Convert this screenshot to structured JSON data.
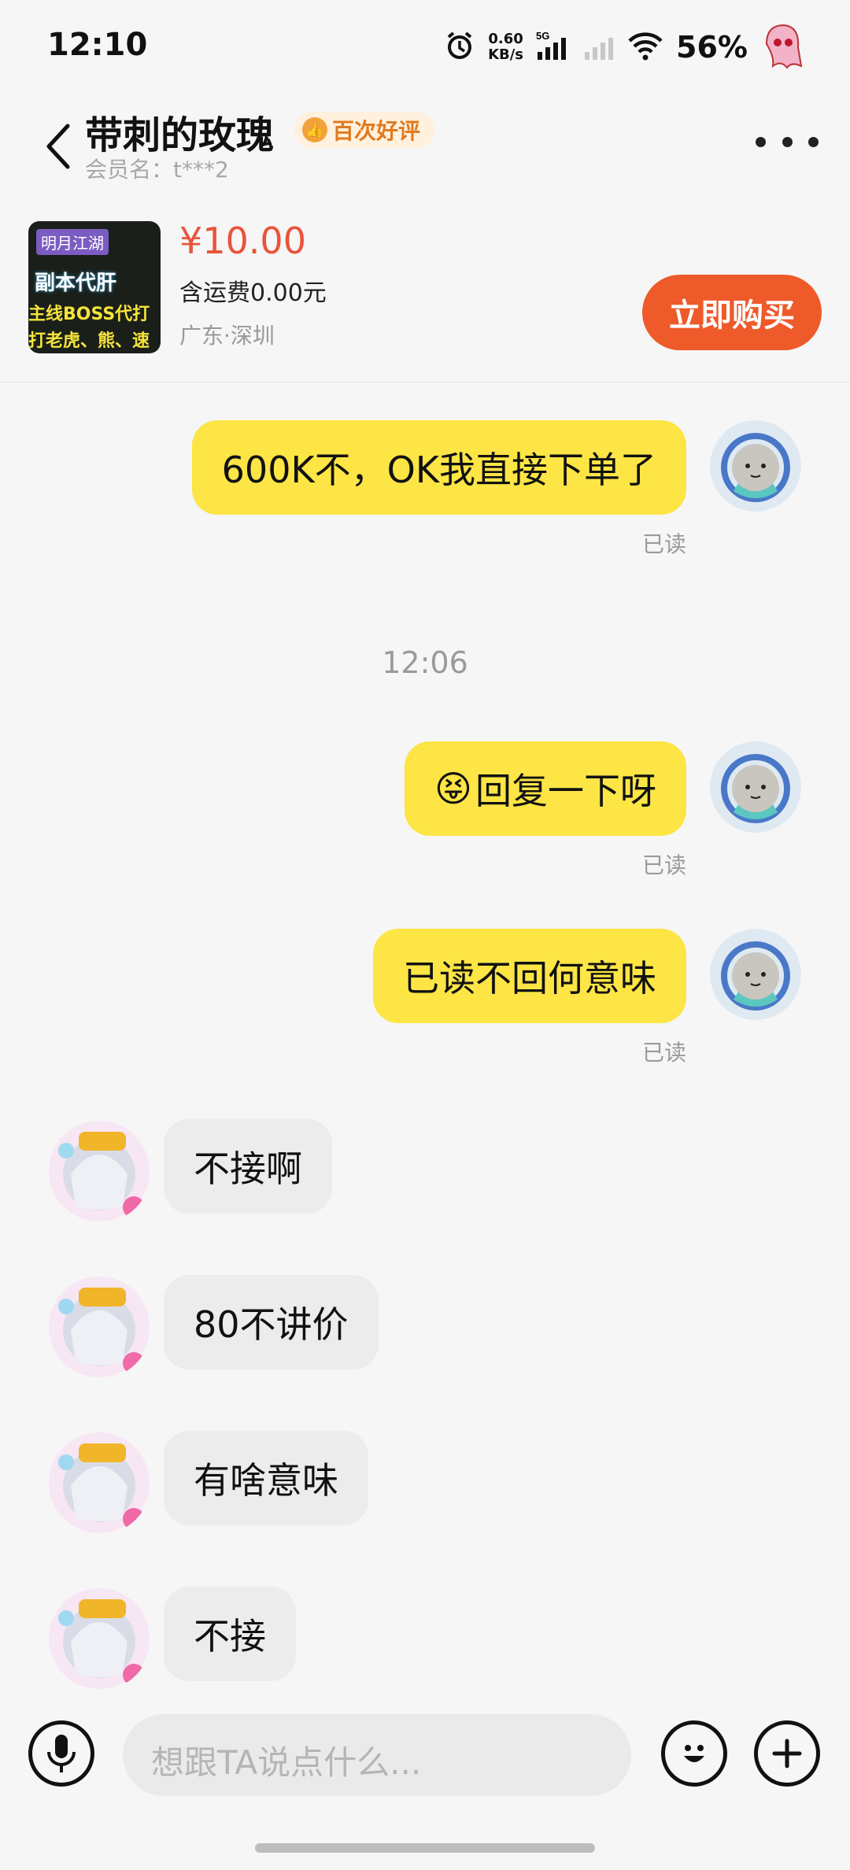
{
  "status_bar": {
    "time": "12:10",
    "net_speed_value": "0.60",
    "net_speed_unit": "KB/s",
    "network": "5G",
    "battery": "56%"
  },
  "header": {
    "title": "带刺的玫瑰",
    "badge": "百次好评",
    "member": "会员名：t***2"
  },
  "product": {
    "price": "¥10.00",
    "shipping": "含运费0.00元",
    "location": "广东·深圳",
    "buy_label": "立即购买",
    "thumb_text": {
      "line1": "明月江湖",
      "line2": "副本代肝",
      "line3": "主线BOSS代打",
      "line4": "打老虎、熊、速"
    }
  },
  "messages": [
    {
      "dir": "out",
      "text": "600K不，OK我直接下单了",
      "read": "已读"
    },
    {
      "dir": "time",
      "text": "12:06"
    },
    {
      "dir": "out",
      "text": "回复一下呀",
      "read": "已读",
      "emoji": "😝"
    },
    {
      "dir": "out",
      "text": "已读不回何意味",
      "read": "已读"
    },
    {
      "dir": "in",
      "text": "不接啊"
    },
    {
      "dir": "in",
      "text": "80不讲价"
    },
    {
      "dir": "in",
      "text": "有啥意味"
    },
    {
      "dir": "in",
      "text": "不接"
    }
  ],
  "composer": {
    "placeholder": "想跟TA说点什么..."
  },
  "colors": {
    "accent": "#ee5a2a",
    "price": "#e8543a",
    "my_bubble": "#fce545",
    "their_bubble": "#ececed"
  }
}
